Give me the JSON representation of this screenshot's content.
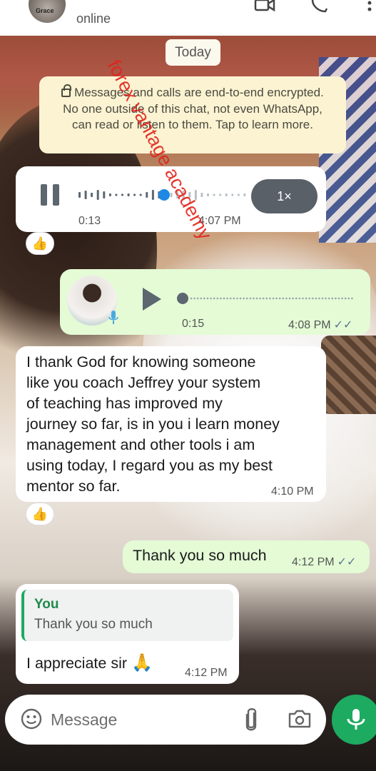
{
  "header": {
    "avatar_text": "Grace",
    "status": "online",
    "icons": [
      "video-call-icon",
      "phone-call-icon",
      "more-options-icon"
    ]
  },
  "date_chip": "Today",
  "encryption_notice": "Messages and calls are end-to-end encrypted. No one outside of this chat, not even WhatsApp, can read or listen to them. Tap to learn more.",
  "watermark": "forex vantage academy",
  "messages": [
    {
      "type": "voice",
      "direction": "incoming",
      "duration": "0:13",
      "time": "4:07 PM",
      "speed": "1×",
      "reaction": "👍",
      "playback_progress": 0.5
    },
    {
      "type": "voice",
      "direction": "outgoing",
      "duration": "0:15",
      "time": "4:08 PM",
      "status_ticks": "✓✓"
    },
    {
      "type": "text",
      "direction": "incoming",
      "lines": [
        "I thank God for knowing someone",
        "like you coach Jeffrey your system",
        "of teaching has improved my",
        "journey so far, is in you i learn money",
        "management and other tools i am",
        "using today, I regard you as my best",
        "mentor so far."
      ],
      "time": "4:10 PM",
      "reaction": "👍"
    },
    {
      "type": "text",
      "direction": "outgoing",
      "text": "Thank you so much",
      "time": "4:12 PM",
      "status_ticks": "✓✓"
    },
    {
      "type": "reply",
      "direction": "incoming",
      "quote_author": "You",
      "quote_text": "Thank you so much",
      "text": "I appreciate sir",
      "emoji": "🙏",
      "time": "4:12 PM"
    }
  ],
  "input_bar": {
    "placeholder": "Message",
    "icons": [
      "emoji-icon",
      "attach-icon",
      "camera-icon",
      "mic-icon"
    ]
  },
  "colors": {
    "outgoing_bubble": "#e4fbd6",
    "incoming_bubble": "#ffffff",
    "accent_green": "#1daa61",
    "ticks": "#5d7890",
    "encryption_bg": "#fcf3d2",
    "watermark_red": "#e0241c"
  }
}
